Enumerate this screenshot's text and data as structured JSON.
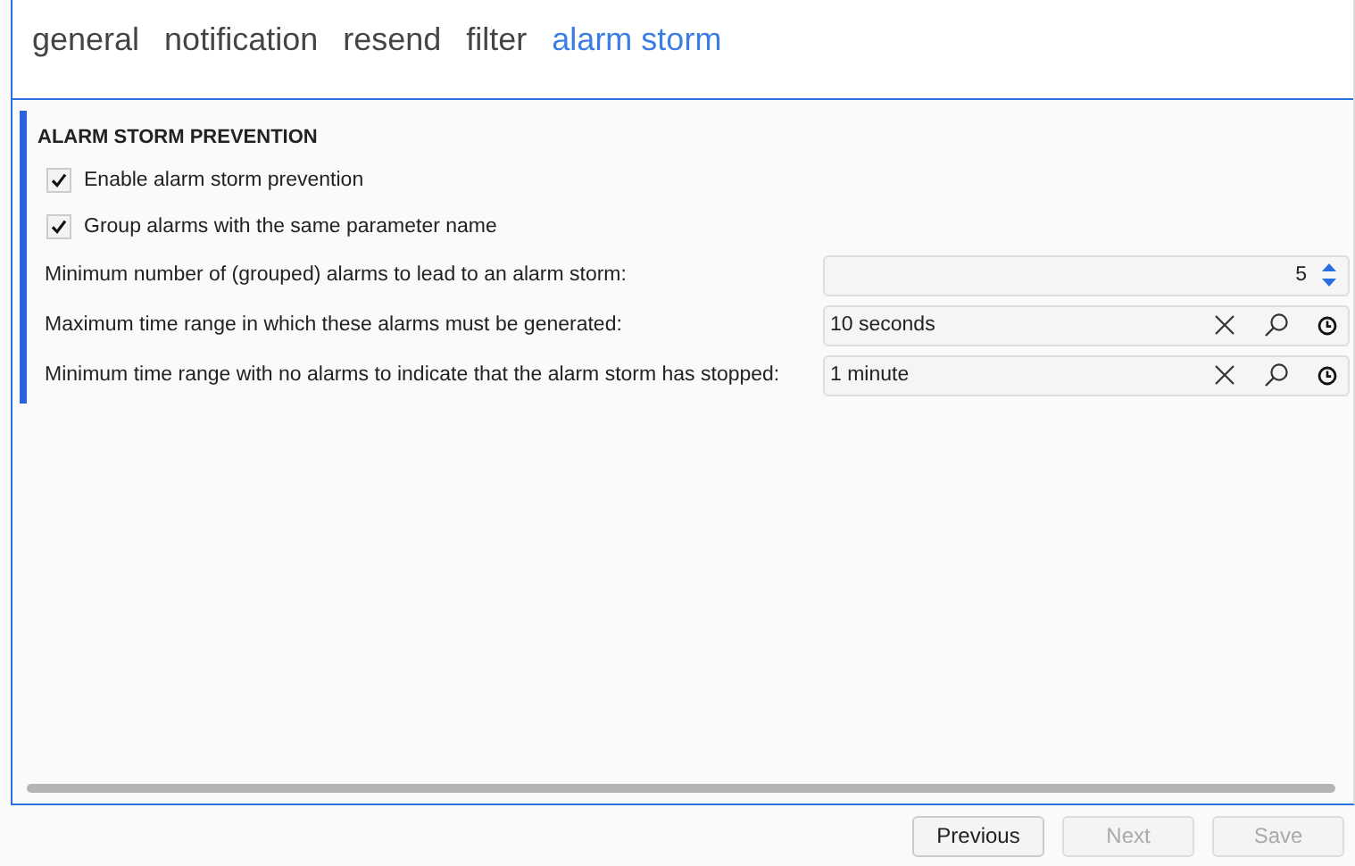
{
  "tabs": [
    {
      "label": "general",
      "selected": false
    },
    {
      "label": "notification",
      "selected": false
    },
    {
      "label": "resend",
      "selected": false
    },
    {
      "label": "filter",
      "selected": false
    },
    {
      "label": "alarm storm",
      "selected": true
    }
  ],
  "section": {
    "title": "ALARM STORM PREVENTION",
    "checkboxes": [
      {
        "label": "Enable alarm storm prevention",
        "checked": true
      },
      {
        "label": "Group alarms with the same parameter name",
        "checked": true
      }
    ],
    "fields": [
      {
        "kind": "spinner",
        "label": "Minimum number of (grouped) alarms to lead to an alarm storm:",
        "value": "5"
      },
      {
        "kind": "time",
        "label": "Maximum time range in which these alarms must be generated:",
        "value": "10 seconds"
      },
      {
        "kind": "time",
        "label": "Minimum time range with no alarms to indicate that the alarm storm has stopped:",
        "value": "1 minute"
      }
    ]
  },
  "buttons": [
    {
      "label": "Previous",
      "disabled": false
    },
    {
      "label": "Next",
      "disabled": true
    },
    {
      "label": "Save",
      "disabled": true
    }
  ]
}
